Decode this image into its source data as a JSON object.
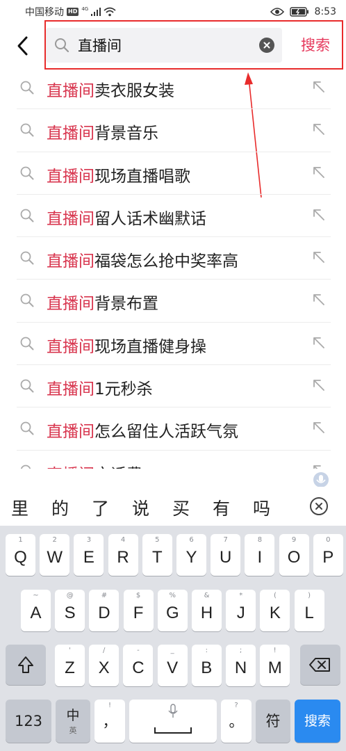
{
  "status_bar": {
    "carrier": "中国移动",
    "hd": "HD",
    "network": "4G",
    "time": "8:53"
  },
  "search": {
    "query": "直播间",
    "submit_label": "搜索"
  },
  "suggestions": [
    {
      "keyword": "直播间",
      "rest": "卖衣服女装"
    },
    {
      "keyword": "直播间",
      "rest": "背景音乐"
    },
    {
      "keyword": "直播间",
      "rest": "现场直播唱歌"
    },
    {
      "keyword": "直播间",
      "rest": "留人话术幽默话"
    },
    {
      "keyword": "直播间",
      "rest": "福袋怎么抢中奖率高"
    },
    {
      "keyword": "直播间",
      "rest": "背景布置"
    },
    {
      "keyword": "直播间",
      "rest": "现场直播健身操"
    },
    {
      "keyword": "直播间",
      "rest": "1元秒杀"
    },
    {
      "keyword": "直播间",
      "rest": "怎么留住人活跃气氛"
    },
    {
      "keyword": "直播间",
      "rest": "充话费"
    }
  ],
  "candidates": [
    "里",
    "的",
    "了",
    "说",
    "买",
    "有",
    "吗"
  ],
  "keyboard": {
    "row1": [
      {
        "hint": "1",
        "key": "Q"
      },
      {
        "hint": "2",
        "key": "W"
      },
      {
        "hint": "3",
        "key": "E"
      },
      {
        "hint": "4",
        "key": "R"
      },
      {
        "hint": "5",
        "key": "T"
      },
      {
        "hint": "6",
        "key": "Y"
      },
      {
        "hint": "7",
        "key": "U"
      },
      {
        "hint": "8",
        "key": "I"
      },
      {
        "hint": "9",
        "key": "O"
      },
      {
        "hint": "0",
        "key": "P"
      }
    ],
    "row2": [
      {
        "hint": "~",
        "key": "A"
      },
      {
        "hint": "@",
        "key": "S"
      },
      {
        "hint": "#",
        "key": "D"
      },
      {
        "hint": "$",
        "key": "F"
      },
      {
        "hint": "%",
        "key": "G"
      },
      {
        "hint": "&",
        "key": "H"
      },
      {
        "hint": "*",
        "key": "J"
      },
      {
        "hint": "(",
        "key": "K"
      },
      {
        "hint": ")",
        "key": "L"
      }
    ],
    "row3": [
      {
        "hint": "'",
        "key": "Z"
      },
      {
        "hint": "/",
        "key": "X"
      },
      {
        "hint": "-",
        "key": "C"
      },
      {
        "hint": "_",
        "key": "V"
      },
      {
        "hint": ":",
        "key": "B"
      },
      {
        "hint": ";",
        "key": "N"
      },
      {
        "hint": "!",
        "key": "M"
      }
    ],
    "num_label": "123",
    "lang_top": "中",
    "lang_bottom": "英",
    "comma": "，",
    "comma_hint": "!",
    "period": "。",
    "period_hint": "?",
    "symbol_label": "符",
    "search_label": "搜索"
  }
}
